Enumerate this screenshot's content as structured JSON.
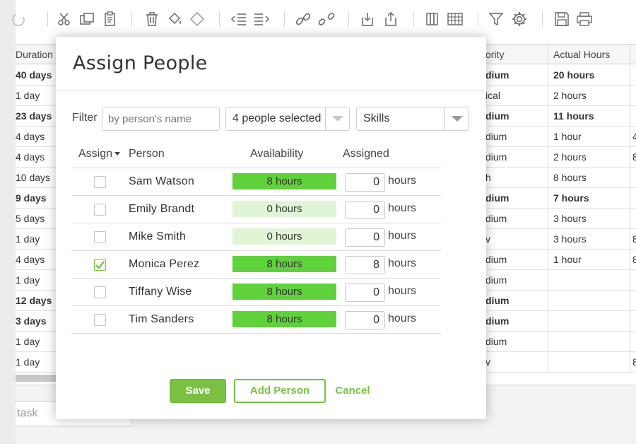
{
  "grid": {
    "columns": {
      "duration": "Duration",
      "priority": "ority",
      "actual_hours": "Actual Hours"
    },
    "rows": [
      {
        "duration": "40 days",
        "priority": "dium",
        "actual": "20 hours",
        "extra": "",
        "bold": true
      },
      {
        "duration": "1 day",
        "priority": "ical",
        "actual": "2 hours",
        "extra": "",
        "bold": false
      },
      {
        "duration": "23 days",
        "priority": "dium",
        "actual": "11 hours",
        "extra": "",
        "bold": true
      },
      {
        "duration": "4 days",
        "priority": "dium",
        "actual": "1 hour",
        "extra": "4",
        "bold": false
      },
      {
        "duration": "4 days",
        "priority": "dium",
        "actual": "2 hours",
        "extra": "8",
        "bold": false
      },
      {
        "duration": "10 days",
        "priority": "h",
        "actual": "8 hours",
        "extra": "",
        "bold": false
      },
      {
        "duration": "9 days",
        "priority": "dium",
        "actual": "7 hours",
        "extra": "",
        "bold": true
      },
      {
        "duration": "5 days",
        "priority": "dium",
        "actual": "3 hours",
        "extra": "",
        "bold": false
      },
      {
        "duration": "1 day",
        "priority": "v",
        "actual": "3 hours",
        "extra": "8",
        "bold": false
      },
      {
        "duration": "4 days",
        "priority": "dium",
        "actual": "1 hour",
        "extra": "8",
        "bold": false
      },
      {
        "duration": "1 day",
        "priority": "dium",
        "actual": "",
        "extra": "",
        "bold": false
      },
      {
        "duration": "12 days",
        "priority": "dium",
        "actual": "",
        "extra": "",
        "bold": true
      },
      {
        "duration": "3 days",
        "priority": "dium",
        "actual": "",
        "extra": "",
        "bold": true
      },
      {
        "duration": "1 day",
        "priority": "dium",
        "actual": "",
        "extra": "",
        "bold": false
      },
      {
        "duration": "1 day",
        "priority": "v",
        "actual": "",
        "extra": "8",
        "bold": false
      }
    ]
  },
  "task_input": {
    "placeholder": "task"
  },
  "modal": {
    "title": "Assign People",
    "filter_label": "Filter",
    "filter_placeholder": "by person's name",
    "people_select": "4 people selected",
    "skills_select": "Skills",
    "headers": {
      "assign": "Assign",
      "person": "Person",
      "availability": "Availability",
      "assigned": "Assigned"
    },
    "people": [
      {
        "name": "Sam Watson",
        "availability": "8 hours",
        "assigned": "0",
        "unit": "hours",
        "checked": false
      },
      {
        "name": "Emily Brandt",
        "availability": "0 hours",
        "assigned": "0",
        "unit": "hours",
        "checked": false
      },
      {
        "name": "Mike Smith",
        "availability": "0 hours",
        "assigned": "0",
        "unit": "hours",
        "checked": false
      },
      {
        "name": "Monica Perez",
        "availability": "8 hours",
        "assigned": "8",
        "unit": "hours",
        "checked": true
      },
      {
        "name": "Tiffany Wise",
        "availability": "8 hours",
        "assigned": "0",
        "unit": "hours",
        "checked": false
      },
      {
        "name": "Tim Sanders",
        "availability": "8 hours",
        "assigned": "0",
        "unit": "hours",
        "checked": false
      }
    ],
    "buttons": {
      "save": "Save",
      "add_person": "Add Person",
      "cancel": "Cancel"
    }
  },
  "colors": {
    "accent": "#7ac143",
    "available": "#5fd13a",
    "unavailable": "#dff5d6"
  }
}
